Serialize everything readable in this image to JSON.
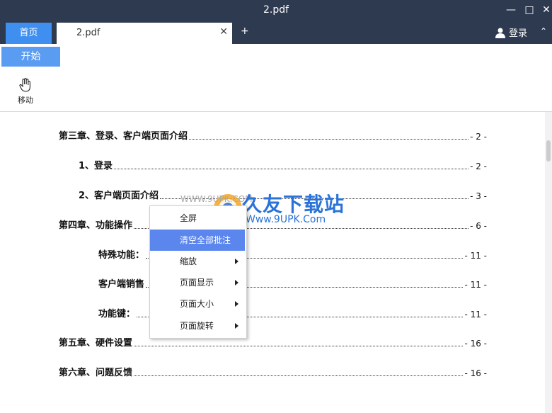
{
  "window": {
    "title": "2.pdf"
  },
  "tabs": {
    "home": "首页",
    "doc": "2.pdf",
    "close": "✕",
    "add": "+"
  },
  "header": {
    "login": "登录"
  },
  "toolbar": {
    "start": "开始",
    "move": "移动"
  },
  "toc": [
    {
      "text": "第三章、登录、客户端页面介绍",
      "page": "- 2 -"
    },
    {
      "text": "1、登录",
      "page": "- 2 -"
    },
    {
      "text": "2、客户端页面介绍",
      "page": "- 3 -"
    },
    {
      "text": "第四章、功能操作",
      "page": "- 6 -"
    },
    {
      "text": "特殊功能：",
      "page": "- 11 -"
    },
    {
      "text": "客户端销售",
      "page": "- 11 -"
    },
    {
      "text": "功能键：",
      "page": "- 11 -"
    },
    {
      "text": "第五章、硬件设置",
      "page": "- 16 -"
    },
    {
      "text": "第六章、问题反馈",
      "page": "- 16 -"
    }
  ],
  "menu": [
    {
      "label": "全屏",
      "submenu": false
    },
    {
      "label": "清空全部批注",
      "submenu": false,
      "active": true
    },
    {
      "label": "缩放",
      "submenu": true
    },
    {
      "label": "页面显示",
      "submenu": true
    },
    {
      "label": "页面大小",
      "submenu": true
    },
    {
      "label": "页面旋转",
      "submenu": true
    }
  ],
  "watermark": {
    "brand": "久友下载站",
    "url": "Www.9UPK.Com",
    "left": "WWW.9UPK.COM"
  },
  "colors": {
    "titlebar": "#2d3a4f",
    "accent": "#3f8ff0",
    "menu_active": "#5b86ee"
  }
}
